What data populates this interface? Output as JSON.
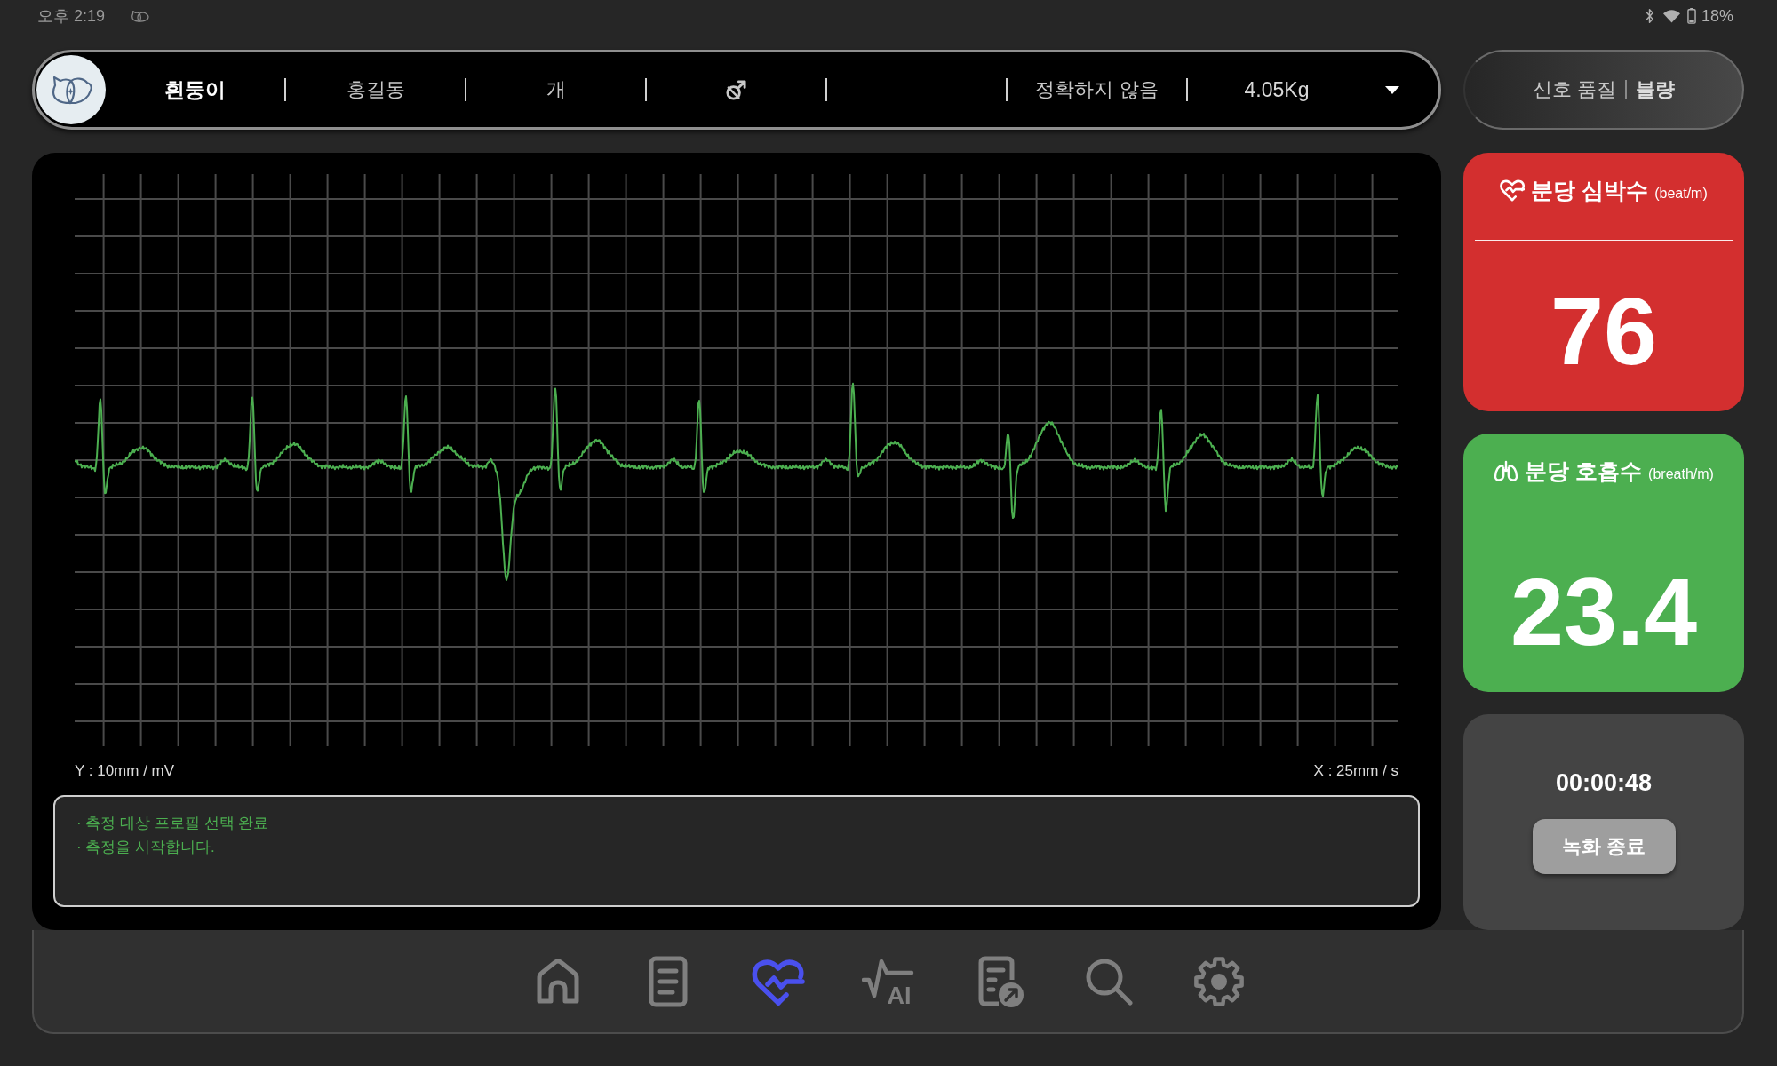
{
  "status_bar": {
    "time": "오후 2:19",
    "battery": "18%"
  },
  "patient_bar": {
    "fields": [
      {
        "kind": "name",
        "text": "흰둥이"
      },
      {
        "kind": "text",
        "text": "홍길동"
      },
      {
        "kind": "text",
        "text": "개"
      },
      {
        "kind": "sex"
      },
      {
        "kind": "blank"
      },
      {
        "kind": "text",
        "text": "정확하지 않음"
      },
      {
        "kind": "weight",
        "text": "4.05Kg"
      }
    ]
  },
  "signal_quality": {
    "label": "신호 품질",
    "value": "불량"
  },
  "ecg": {
    "y_scale": "Y : 10mm / mV",
    "x_scale": "X : 25mm / s",
    "log": [
      "· 측정 대상 프로필 선택 완료",
      "· 측정을 시작합니다."
    ]
  },
  "vitals": [
    {
      "kind": "heart_rate",
      "title": "분당 심박수",
      "unit": "(beat/m)",
      "value": "76",
      "color": "#d32f2f"
    },
    {
      "kind": "respiration",
      "title": "분당 호흡수",
      "unit": "(breath/m)",
      "value": "23.4",
      "color": "#4caf50"
    }
  ],
  "recording": {
    "elapsed": "00:00:48",
    "button": "녹화 종료"
  },
  "nav": {
    "items": [
      {
        "kind": "home",
        "selected": false
      },
      {
        "kind": "document",
        "selected": false
      },
      {
        "kind": "heart_monitor",
        "selected": true
      },
      {
        "kind": "ai_analysis",
        "label": "AI",
        "selected": false
      },
      {
        "kind": "report_export",
        "selected": false
      },
      {
        "kind": "search",
        "selected": false
      },
      {
        "kind": "settings",
        "selected": false
      }
    ]
  }
}
